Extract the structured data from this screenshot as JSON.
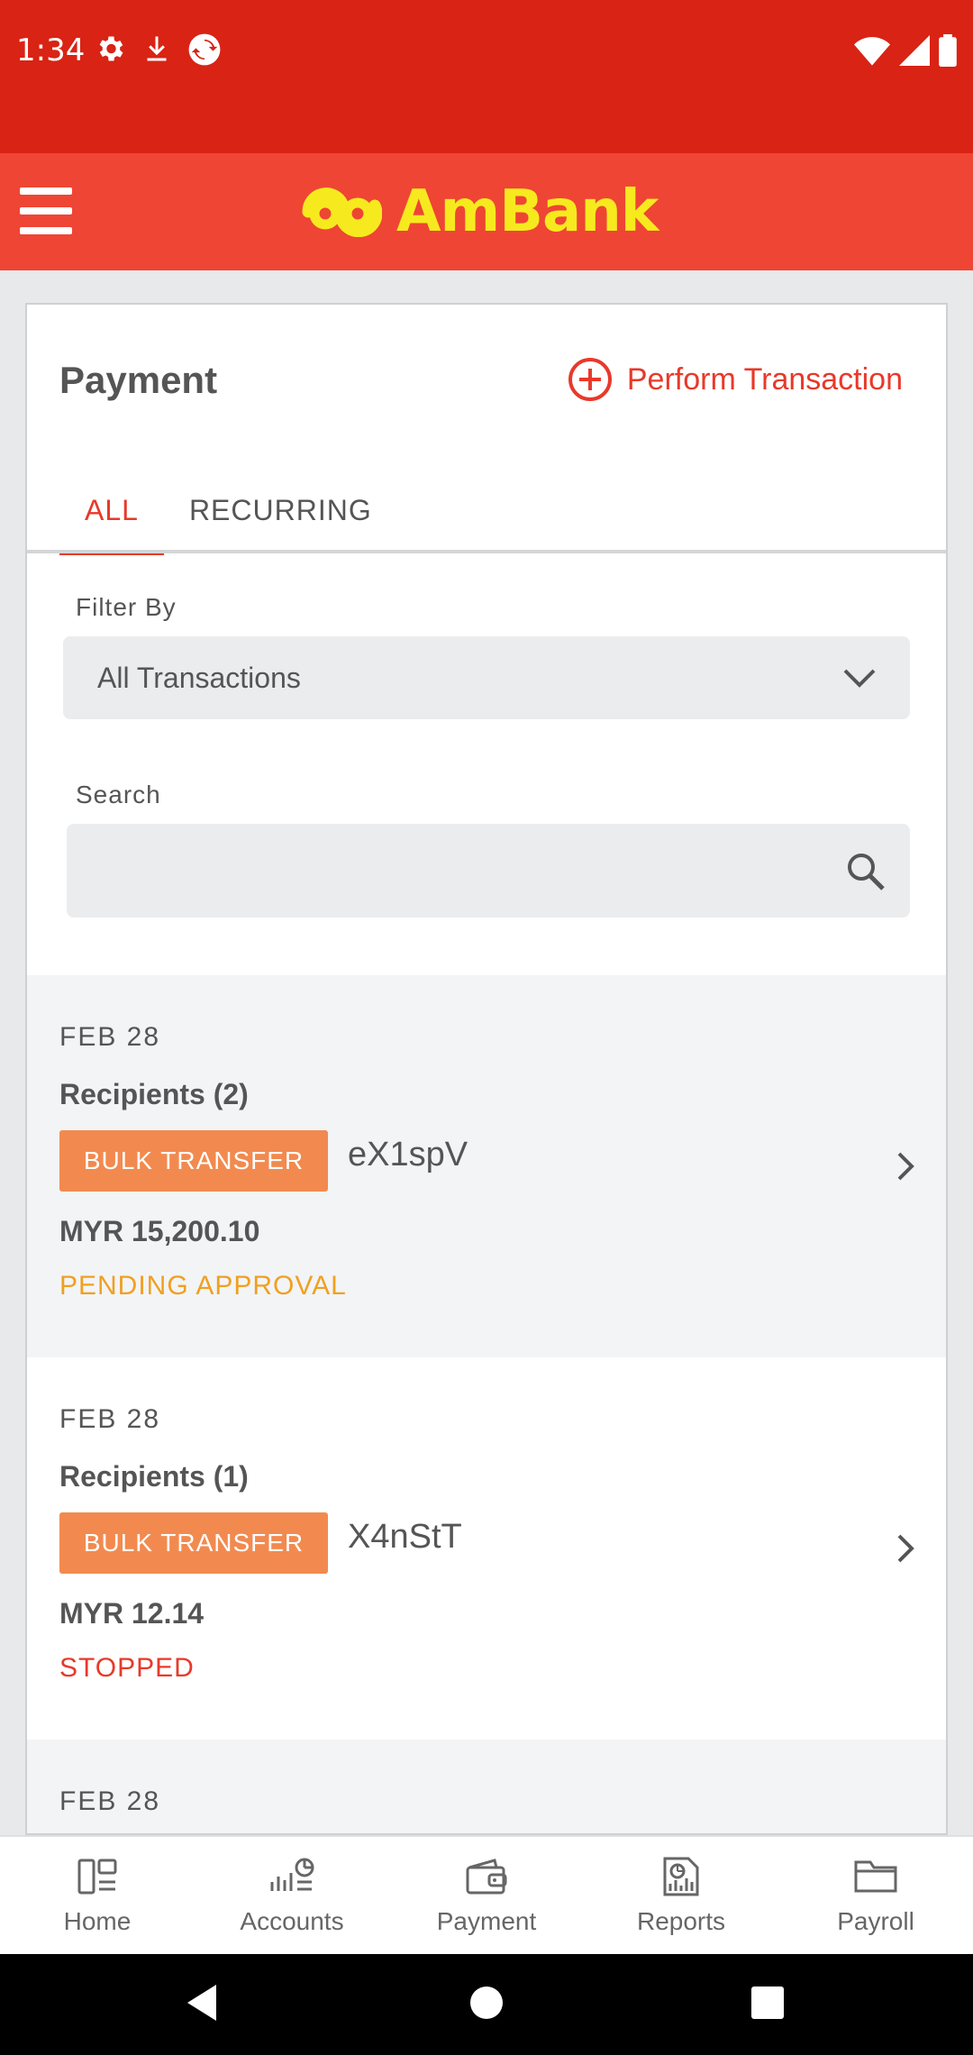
{
  "status_bar": {
    "time": "1:34"
  },
  "app": {
    "brand": "AmBank",
    "colors": {
      "header": "#ef4534",
      "status_bar": "#d92314",
      "accent": "#e8392a",
      "logo": "#f6ea1e",
      "badge": "#f28a4f",
      "pending": "#f0a020",
      "stopped": "#e8392a"
    }
  },
  "page": {
    "title": "Payment",
    "perform_label": "Perform Transaction",
    "tabs": [
      {
        "label": "ALL",
        "active": true
      },
      {
        "label": "RECURRING",
        "active": false
      }
    ]
  },
  "filter": {
    "label": "Filter By",
    "selected": "All Transactions"
  },
  "search": {
    "label": "Search",
    "value": "",
    "placeholder": ""
  },
  "transactions": [
    {
      "date": "FEB  28",
      "recipients": "Recipients (2)",
      "type": "BULK TRANSFER",
      "ref": "eX1spV",
      "amount": "MYR 15,200.10",
      "status": "PENDING APPROVAL"
    },
    {
      "date": "FEB  28",
      "recipients": "Recipients (1)",
      "type": "BULK TRANSFER",
      "ref": "X4nStT",
      "amount": "MYR 12.14",
      "status": "STOPPED"
    },
    {
      "date": "FEB  28"
    }
  ],
  "bottom_nav": [
    {
      "label": "Home",
      "icon": "home-icon"
    },
    {
      "label": "Accounts",
      "icon": "accounts-icon"
    },
    {
      "label": "Payment",
      "icon": "wallet-icon"
    },
    {
      "label": "Reports",
      "icon": "reports-icon"
    },
    {
      "label": "Payroll",
      "icon": "folder-icon"
    }
  ]
}
